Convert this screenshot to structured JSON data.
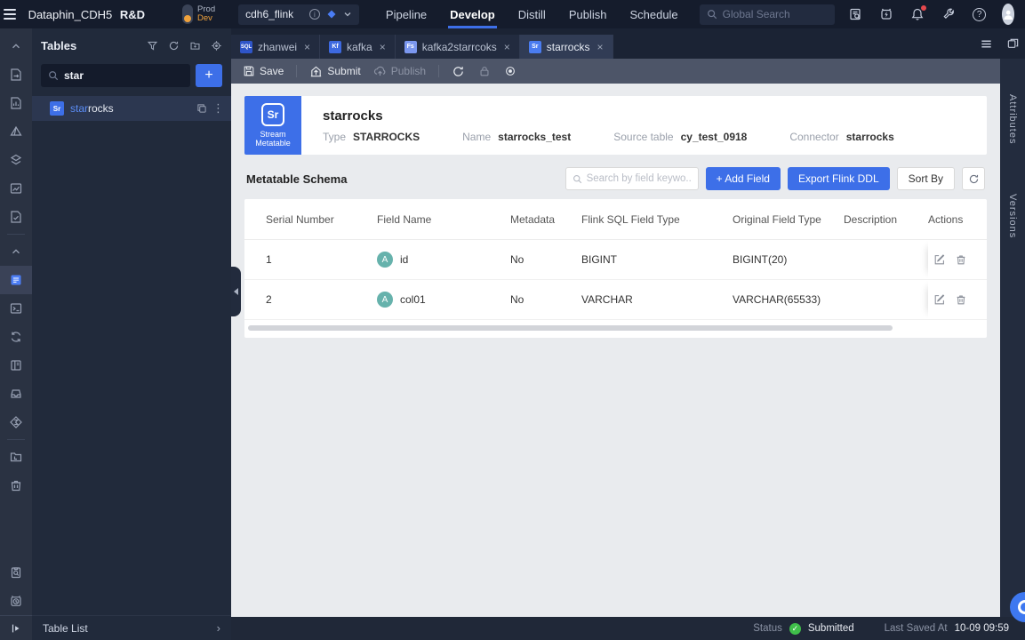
{
  "topbar": {
    "product": "Dataphin_CDH5",
    "product_badge": "R&D",
    "env": {
      "prod": "Prod",
      "dev": "Dev"
    },
    "project": "cdh6_flink",
    "nav": [
      "Pipeline",
      "Develop",
      "Distill",
      "Publish",
      "Schedule"
    ],
    "search_placeholder": "Global Search"
  },
  "icons": {
    "close": "×",
    "more": "⋮",
    "chevron_right": "›",
    "question": "?",
    "info": "i",
    "plus": "+",
    "check": "✓",
    "terminal": ">_"
  },
  "tables_panel": {
    "title": "Tables",
    "search_value": "star",
    "item": {
      "badge": "Sr",
      "match": "star",
      "rest": "rocks"
    },
    "footer": "Table List"
  },
  "tabs": [
    {
      "badge": "SQL",
      "label": "zhanwei"
    },
    {
      "badge": "Kf",
      "label": "kafka"
    },
    {
      "badge": "Fs",
      "label": "kafka2starrcoks"
    },
    {
      "badge": "Sr",
      "label": "starrocks"
    }
  ],
  "toolbar": {
    "save": "Save",
    "submit": "Submit",
    "publish": "Publish"
  },
  "detail": {
    "logo_initials": "Sr",
    "logo_caption_line1": "Stream",
    "logo_caption_line2": "Metatable",
    "title": "starrocks",
    "meta": [
      {
        "label": "Type",
        "value": "STARROCKS"
      },
      {
        "label": "Name",
        "value": "starrocks_test"
      },
      {
        "label": "Source table",
        "value": "cy_test_0918"
      },
      {
        "label": "Connector",
        "value": "starrocks"
      }
    ]
  },
  "schema": {
    "title": "Metatable Schema",
    "search_placeholder": "Search by field keywo...",
    "add_field_label": "+ Add Field",
    "export_label": "Export Flink DDL",
    "sort_label": "Sort By",
    "columns": [
      "Serial Number",
      "Field Name",
      "Metadata",
      "Flink SQL Field Type",
      "Original Field Type",
      "Description",
      "Actions"
    ],
    "rows": [
      {
        "serial": "1",
        "field_badge": "A",
        "field": "id",
        "metadata": "No",
        "flink_type": "BIGINT",
        "original_type": "BIGINT(20)",
        "description": ""
      },
      {
        "serial": "2",
        "field_badge": "A",
        "field": "col01",
        "metadata": "No",
        "flink_type": "VARCHAR",
        "original_type": "VARCHAR(65533)",
        "description": ""
      }
    ]
  },
  "right_panel": {
    "tabs": [
      "Attributes",
      "Versions"
    ]
  },
  "statusbar": {
    "status_label": "Status",
    "status_value": "Submitted",
    "saved_label": "Last Saved At",
    "saved_value": "10-09 09:59"
  },
  "colors": {
    "accent_blue": "#3d6fe8",
    "dev_orange": "#f0a23c",
    "success_green": "#3fbf4a",
    "teal_field_badge": "#66b2ac",
    "notification_red": "#e5484d"
  }
}
